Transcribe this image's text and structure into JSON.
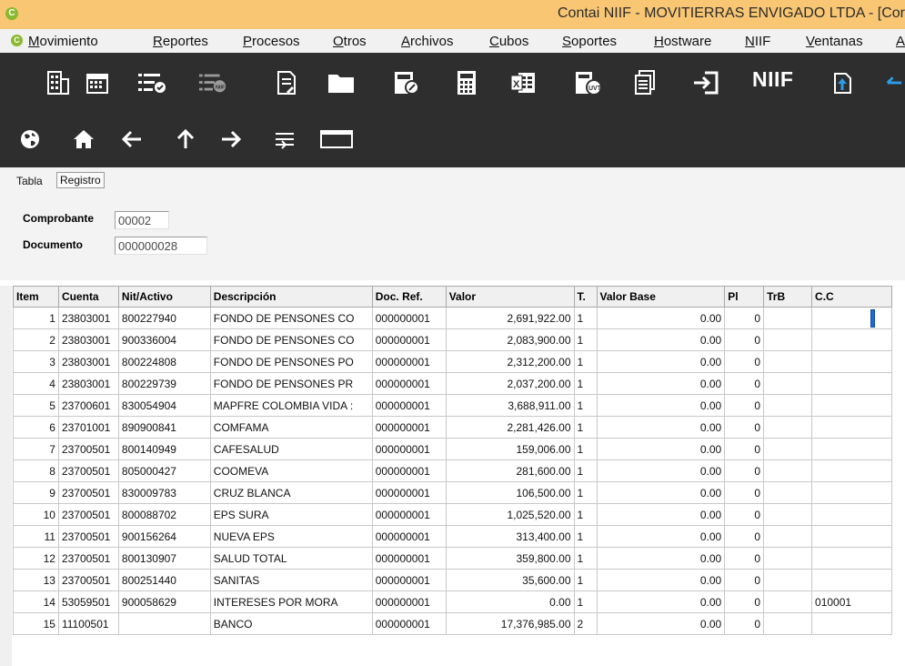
{
  "window": {
    "title": "Contai NIIF - MOVITIERRAS ENVIGADO LTDA - [Cor",
    "logo": "C"
  },
  "menu": [
    {
      "label": "Movimiento"
    },
    {
      "label": "Reportes"
    },
    {
      "label": "Procesos"
    },
    {
      "label": "Otros"
    },
    {
      "label": "Archivos"
    },
    {
      "label": "Cubos"
    },
    {
      "label": "Soportes"
    },
    {
      "label": "Hostware"
    },
    {
      "label": "NIIF"
    },
    {
      "label": "Ventanas"
    },
    {
      "label": "A"
    }
  ],
  "toolbar": {
    "niif_label": "NIIF",
    "icons": [
      "building-icon",
      "calendar-icon",
      "checklist-icon",
      "niif-list-icon",
      "document-edit-icon",
      "folder-icon",
      "calculator-edit-icon",
      "calculator-icon",
      "excel-icon",
      "uvt-icon",
      "documents-icon",
      "exit-icon",
      "niif-icon",
      "upload-icon"
    ]
  },
  "nav_icons": [
    "globe-icon",
    "home-icon",
    "back-arrow-icon",
    "up-arrow-icon",
    "forward-arrow-icon",
    "list-icon",
    "window-icon"
  ],
  "tabs": {
    "table": "Tabla",
    "registro": "Registro"
  },
  "form": {
    "comprobante_label": "Comprobante",
    "comprobante_value": "00002",
    "documento_label": "Documento",
    "documento_value": "000000028"
  },
  "grid": {
    "headers": {
      "item": "Item",
      "cuenta": "Cuenta",
      "nit": "Nit/Activo",
      "descripcion": "Descripción",
      "docref": "Doc. Ref.",
      "valor": "Valor",
      "t": "T.",
      "valorbase": "Valor Base",
      "pl": "Pl",
      "trb": "TrB",
      "cc": "C.C"
    },
    "rows": [
      {
        "item": "1",
        "cuenta": "23803001",
        "nit": "800227940",
        "descripcion": "FONDO DE PENSONES CO",
        "docref": "000000001",
        "valor": "2,691,922.00",
        "t": "1",
        "valorbase": "0.00",
        "pl": "0",
        "trb": "",
        "cc": ""
      },
      {
        "item": "2",
        "cuenta": "23803001",
        "nit": "900336004",
        "descripcion": "FONDO DE PENSONES CO",
        "docref": "000000001",
        "valor": "2,083,900.00",
        "t": "1",
        "valorbase": "0.00",
        "pl": "0",
        "trb": "",
        "cc": ""
      },
      {
        "item": "3",
        "cuenta": "23803001",
        "nit": "800224808",
        "descripcion": "FONDO DE PENSONES PO",
        "docref": "000000001",
        "valor": "2,312,200.00",
        "t": "1",
        "valorbase": "0.00",
        "pl": "0",
        "trb": "",
        "cc": ""
      },
      {
        "item": "4",
        "cuenta": "23803001",
        "nit": "800229739",
        "descripcion": "FONDO DE PENSONES PR",
        "docref": "000000001",
        "valor": "2,037,200.00",
        "t": "1",
        "valorbase": "0.00",
        "pl": "0",
        "trb": "",
        "cc": ""
      },
      {
        "item": "5",
        "cuenta": "23700601",
        "nit": "830054904",
        "descripcion": "MAPFRE COLOMBIA VIDA :",
        "docref": "000000001",
        "valor": "3,688,911.00",
        "t": "1",
        "valorbase": "0.00",
        "pl": "0",
        "trb": "",
        "cc": ""
      },
      {
        "item": "6",
        "cuenta": "23701001",
        "nit": "890900841",
        "descripcion": "COMFAMA",
        "docref": "000000001",
        "valor": "2,281,426.00",
        "t": "1",
        "valorbase": "0.00",
        "pl": "0",
        "trb": "",
        "cc": ""
      },
      {
        "item": "7",
        "cuenta": "23700501",
        "nit": "800140949",
        "descripcion": "CAFESALUD",
        "docref": "000000001",
        "valor": "159,006.00",
        "t": "1",
        "valorbase": "0.00",
        "pl": "0",
        "trb": "",
        "cc": ""
      },
      {
        "item": "8",
        "cuenta": "23700501",
        "nit": "805000427",
        "descripcion": "COOMEVA",
        "docref": "000000001",
        "valor": "281,600.00",
        "t": "1",
        "valorbase": "0.00",
        "pl": "0",
        "trb": "",
        "cc": ""
      },
      {
        "item": "9",
        "cuenta": "23700501",
        "nit": "830009783",
        "descripcion": "CRUZ BLANCA",
        "docref": "000000001",
        "valor": "106,500.00",
        "t": "1",
        "valorbase": "0.00",
        "pl": "0",
        "trb": "",
        "cc": ""
      },
      {
        "item": "10",
        "cuenta": "23700501",
        "nit": "800088702",
        "descripcion": "EPS SURA",
        "docref": "000000001",
        "valor": "1,025,520.00",
        "t": "1",
        "valorbase": "0.00",
        "pl": "0",
        "trb": "",
        "cc": ""
      },
      {
        "item": "11",
        "cuenta": "23700501",
        "nit": "900156264",
        "descripcion": "NUEVA EPS",
        "docref": "000000001",
        "valor": "313,400.00",
        "t": "1",
        "valorbase": "0.00",
        "pl": "0",
        "trb": "",
        "cc": ""
      },
      {
        "item": "12",
        "cuenta": "23700501",
        "nit": "800130907",
        "descripcion": "SALUD TOTAL",
        "docref": "000000001",
        "valor": "359,800.00",
        "t": "1",
        "valorbase": "0.00",
        "pl": "0",
        "trb": "",
        "cc": ""
      },
      {
        "item": "13",
        "cuenta": "23700501",
        "nit": "800251440",
        "descripcion": "SANITAS",
        "docref": "000000001",
        "valor": "35,600.00",
        "t": "1",
        "valorbase": "0.00",
        "pl": "0",
        "trb": "",
        "cc": ""
      },
      {
        "item": "14",
        "cuenta": "53059501",
        "nit": "900058629",
        "descripcion": "INTERESES POR MORA",
        "docref": "000000001",
        "valor": "0.00",
        "t": "1",
        "valorbase": "0.00",
        "pl": "0",
        "trb": "",
        "cc": "010001"
      },
      {
        "item": "15",
        "cuenta": "11100501",
        "nit": "",
        "descripcion": "BANCO",
        "docref": "000000001",
        "valor": "17,376,985.00",
        "t": "2",
        "valorbase": "0.00",
        "pl": "0",
        "trb": "",
        "cc": ""
      }
    ]
  }
}
